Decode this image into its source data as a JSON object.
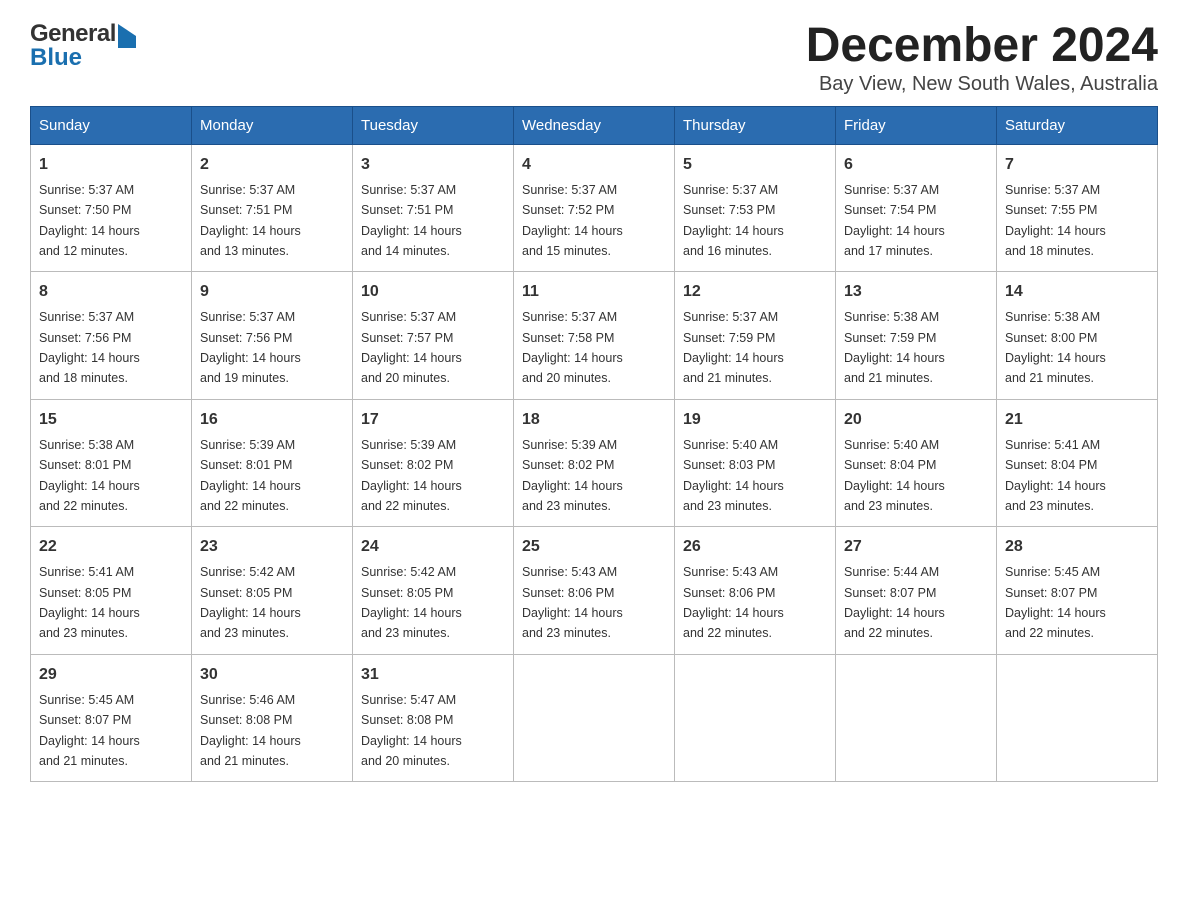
{
  "logo": {
    "line1": "General",
    "line2": "Blue"
  },
  "title": "December 2024",
  "subtitle": "Bay View, New South Wales, Australia",
  "headers": [
    "Sunday",
    "Monday",
    "Tuesday",
    "Wednesday",
    "Thursday",
    "Friday",
    "Saturday"
  ],
  "weeks": [
    [
      {
        "day": "1",
        "sunrise": "5:37 AM",
        "sunset": "7:50 PM",
        "daylight": "14 hours and 12 minutes."
      },
      {
        "day": "2",
        "sunrise": "5:37 AM",
        "sunset": "7:51 PM",
        "daylight": "14 hours and 13 minutes."
      },
      {
        "day": "3",
        "sunrise": "5:37 AM",
        "sunset": "7:51 PM",
        "daylight": "14 hours and 14 minutes."
      },
      {
        "day": "4",
        "sunrise": "5:37 AM",
        "sunset": "7:52 PM",
        "daylight": "14 hours and 15 minutes."
      },
      {
        "day": "5",
        "sunrise": "5:37 AM",
        "sunset": "7:53 PM",
        "daylight": "14 hours and 16 minutes."
      },
      {
        "day": "6",
        "sunrise": "5:37 AM",
        "sunset": "7:54 PM",
        "daylight": "14 hours and 17 minutes."
      },
      {
        "day": "7",
        "sunrise": "5:37 AM",
        "sunset": "7:55 PM",
        "daylight": "14 hours and 18 minutes."
      }
    ],
    [
      {
        "day": "8",
        "sunrise": "5:37 AM",
        "sunset": "7:56 PM",
        "daylight": "14 hours and 18 minutes."
      },
      {
        "day": "9",
        "sunrise": "5:37 AM",
        "sunset": "7:56 PM",
        "daylight": "14 hours and 19 minutes."
      },
      {
        "day": "10",
        "sunrise": "5:37 AM",
        "sunset": "7:57 PM",
        "daylight": "14 hours and 20 minutes."
      },
      {
        "day": "11",
        "sunrise": "5:37 AM",
        "sunset": "7:58 PM",
        "daylight": "14 hours and 20 minutes."
      },
      {
        "day": "12",
        "sunrise": "5:37 AM",
        "sunset": "7:59 PM",
        "daylight": "14 hours and 21 minutes."
      },
      {
        "day": "13",
        "sunrise": "5:38 AM",
        "sunset": "7:59 PM",
        "daylight": "14 hours and 21 minutes."
      },
      {
        "day": "14",
        "sunrise": "5:38 AM",
        "sunset": "8:00 PM",
        "daylight": "14 hours and 21 minutes."
      }
    ],
    [
      {
        "day": "15",
        "sunrise": "5:38 AM",
        "sunset": "8:01 PM",
        "daylight": "14 hours and 22 minutes."
      },
      {
        "day": "16",
        "sunrise": "5:39 AM",
        "sunset": "8:01 PM",
        "daylight": "14 hours and 22 minutes."
      },
      {
        "day": "17",
        "sunrise": "5:39 AM",
        "sunset": "8:02 PM",
        "daylight": "14 hours and 22 minutes."
      },
      {
        "day": "18",
        "sunrise": "5:39 AM",
        "sunset": "8:02 PM",
        "daylight": "14 hours and 23 minutes."
      },
      {
        "day": "19",
        "sunrise": "5:40 AM",
        "sunset": "8:03 PM",
        "daylight": "14 hours and 23 minutes."
      },
      {
        "day": "20",
        "sunrise": "5:40 AM",
        "sunset": "8:04 PM",
        "daylight": "14 hours and 23 minutes."
      },
      {
        "day": "21",
        "sunrise": "5:41 AM",
        "sunset": "8:04 PM",
        "daylight": "14 hours and 23 minutes."
      }
    ],
    [
      {
        "day": "22",
        "sunrise": "5:41 AM",
        "sunset": "8:05 PM",
        "daylight": "14 hours and 23 minutes."
      },
      {
        "day": "23",
        "sunrise": "5:42 AM",
        "sunset": "8:05 PM",
        "daylight": "14 hours and 23 minutes."
      },
      {
        "day": "24",
        "sunrise": "5:42 AM",
        "sunset": "8:05 PM",
        "daylight": "14 hours and 23 minutes."
      },
      {
        "day": "25",
        "sunrise": "5:43 AM",
        "sunset": "8:06 PM",
        "daylight": "14 hours and 23 minutes."
      },
      {
        "day": "26",
        "sunrise": "5:43 AM",
        "sunset": "8:06 PM",
        "daylight": "14 hours and 22 minutes."
      },
      {
        "day": "27",
        "sunrise": "5:44 AM",
        "sunset": "8:07 PM",
        "daylight": "14 hours and 22 minutes."
      },
      {
        "day": "28",
        "sunrise": "5:45 AM",
        "sunset": "8:07 PM",
        "daylight": "14 hours and 22 minutes."
      }
    ],
    [
      {
        "day": "29",
        "sunrise": "5:45 AM",
        "sunset": "8:07 PM",
        "daylight": "14 hours and 21 minutes."
      },
      {
        "day": "30",
        "sunrise": "5:46 AM",
        "sunset": "8:08 PM",
        "daylight": "14 hours and 21 minutes."
      },
      {
        "day": "31",
        "sunrise": "5:47 AM",
        "sunset": "8:08 PM",
        "daylight": "14 hours and 20 minutes."
      },
      null,
      null,
      null,
      null
    ]
  ],
  "labels": {
    "sunrise": "Sunrise:",
    "sunset": "Sunset:",
    "daylight": "Daylight:"
  }
}
